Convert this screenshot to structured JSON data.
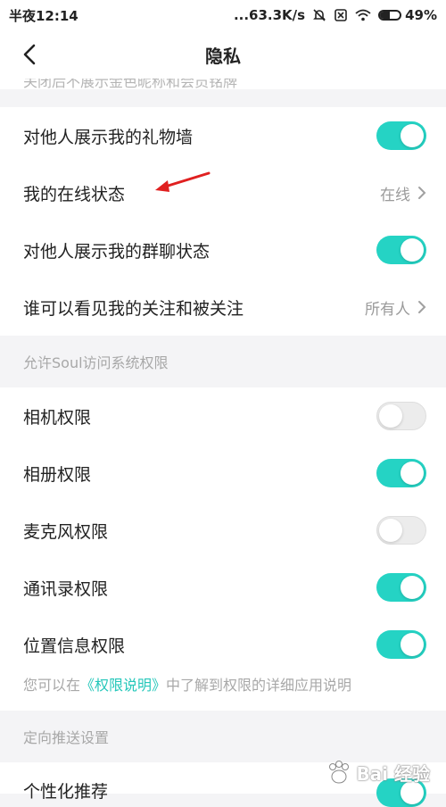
{
  "status": {
    "time": "半夜12:14",
    "network_speed": "...63.3K/s",
    "battery_text": "49%",
    "battery_level": 0.49
  },
  "nav": {
    "title": "隐私",
    "back_icon": "chevron-left-icon"
  },
  "top_hint": "关闭后不展示金色昵称和会员铭牌",
  "privacy_rows": [
    {
      "label": "对他人展示我的礼物墙",
      "type": "toggle",
      "on": true
    },
    {
      "label": "我的在线状态",
      "type": "value",
      "value": "在线"
    },
    {
      "label": "对他人展示我的群聊状态",
      "type": "toggle",
      "on": true
    },
    {
      "label": "谁可以看见我的关注和被关注",
      "type": "value",
      "value": "所有人"
    }
  ],
  "permissions": {
    "header": "允许Soul访问系统权限",
    "rows": [
      {
        "label": "相机权限",
        "on": false
      },
      {
        "label": "相册权限",
        "on": true
      },
      {
        "label": "麦克风权限",
        "on": false
      },
      {
        "label": "通讯录权限",
        "on": true
      },
      {
        "label": "位置信息权限",
        "on": true
      }
    ],
    "note_prefix": "您可以在",
    "note_link": "《权限说明》",
    "note_suffix": "中了解到权限的详细应用说明"
  },
  "push": {
    "header": "定向推送设置",
    "rows": [
      {
        "label": "个性化推荐",
        "on": true
      }
    ]
  },
  "watermark": {
    "text": "Bai 经验"
  },
  "colors": {
    "accent": "#25d3c4",
    "toggle_off": "#ececec",
    "annotation_arrow": "#e02020"
  }
}
